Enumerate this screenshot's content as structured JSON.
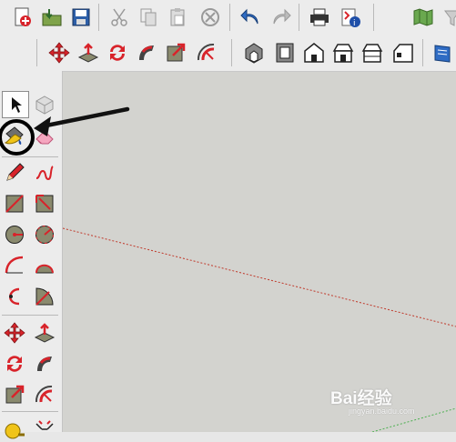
{
  "toolbar_top": {
    "buttons": [
      {
        "id": "new",
        "icon": "new-file-icon"
      },
      {
        "id": "open",
        "icon": "open-folder-icon"
      },
      {
        "id": "save",
        "icon": "save-disk-icon"
      },
      {
        "id": "cut",
        "icon": "scissors-icon"
      },
      {
        "id": "copy",
        "icon": "copy-icon"
      },
      {
        "id": "paste",
        "icon": "paste-icon"
      },
      {
        "id": "erase",
        "icon": "erase-circle-icon"
      },
      {
        "id": "undo",
        "icon": "undo-arrow-icon"
      },
      {
        "id": "redo",
        "icon": "redo-arrow-icon"
      },
      {
        "id": "print",
        "icon": "printer-icon"
      },
      {
        "id": "model-info",
        "icon": "model-info-icon"
      },
      {
        "id": "map",
        "icon": "map-icon"
      },
      {
        "id": "filter",
        "icon": "filter-icon"
      }
    ]
  },
  "toolbar_second": {
    "buttons": [
      {
        "id": "move",
        "icon": "move-arrows-icon"
      },
      {
        "id": "push-pull",
        "icon": "push-pull-icon"
      },
      {
        "id": "rotate",
        "icon": "rotate-icon"
      },
      {
        "id": "follow-me",
        "icon": "follow-me-icon"
      },
      {
        "id": "scale",
        "icon": "scale-icon"
      },
      {
        "id": "offset",
        "icon": "offset-icon"
      },
      {
        "id": "iso",
        "icon": "iso-view-icon"
      },
      {
        "id": "top",
        "icon": "top-view-icon"
      },
      {
        "id": "front",
        "icon": "front-view-icon"
      },
      {
        "id": "right",
        "icon": "right-view-icon"
      },
      {
        "id": "back",
        "icon": "back-view-icon"
      },
      {
        "id": "left",
        "icon": "left-view-icon"
      },
      {
        "id": "warehouse",
        "icon": "warehouse-icon"
      }
    ]
  },
  "left_toolbar": {
    "tools": [
      {
        "id": "select",
        "icon": "cursor-arrow-icon",
        "active": true
      },
      {
        "id": "component",
        "icon": "component-box-icon"
      },
      {
        "id": "paint",
        "icon": "paint-bucket-icon",
        "highlighted": true
      },
      {
        "id": "eraser",
        "icon": "eraser-icon"
      },
      {
        "id": "line",
        "icon": "pencil-line-icon"
      },
      {
        "id": "freehand",
        "icon": "freehand-icon"
      },
      {
        "id": "rectangle",
        "icon": "rectangle-icon"
      },
      {
        "id": "rotated-rectangle",
        "icon": "rotated-rectangle-icon"
      },
      {
        "id": "circle",
        "icon": "circle-icon"
      },
      {
        "id": "polygon",
        "icon": "polygon-icon"
      },
      {
        "id": "arc",
        "icon": "arc-icon"
      },
      {
        "id": "arc2",
        "icon": "two-point-arc-icon"
      },
      {
        "id": "arc3",
        "icon": "three-point-arc-icon"
      },
      {
        "id": "pie",
        "icon": "pie-icon"
      },
      {
        "id": "move",
        "icon": "move-arrows-icon"
      },
      {
        "id": "push-pull",
        "icon": "push-pull-icon"
      },
      {
        "id": "rotate",
        "icon": "rotate-icon"
      },
      {
        "id": "follow-me",
        "icon": "follow-me-icon"
      },
      {
        "id": "scale",
        "icon": "scale-icon"
      },
      {
        "id": "offset",
        "icon": "offset-icon"
      },
      {
        "id": "tape",
        "icon": "tape-measure-icon"
      },
      {
        "id": "dimension",
        "icon": "dimension-icon"
      }
    ]
  },
  "annotation": {
    "arrow_color": "#111111",
    "circle_color": "#000000"
  },
  "colors": {
    "accent_red": "#d8232a",
    "canvas": "#d3d3cf",
    "axis_red": "#c0392b",
    "axis_green": "#4caf50"
  },
  "watermark": {
    "brand": "Bai经验",
    "sub": "jingyan.baidu.com"
  }
}
